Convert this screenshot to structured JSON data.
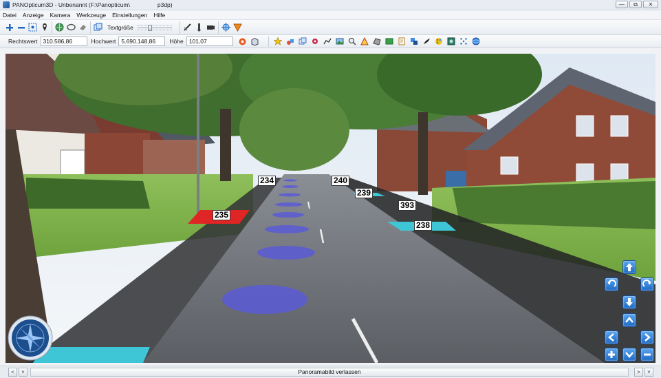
{
  "window": {
    "title_app": "PANOpticum3D - Unbenannt (F:\\Panopticum\\",
    "title_suffix": "p3dp)",
    "btn_minimize": "—",
    "btn_maximize": "⧉",
    "btn_close": "✕"
  },
  "menu": [
    "Datei",
    "Anzeige",
    "Kamera",
    "Werkzeuge",
    "Einstellungen",
    "Hilfe"
  ],
  "toolbar1": {
    "text_size_label": "Textgröße",
    "text_size_level": 0.35
  },
  "toolbar2": {
    "rechtswert_label": "Rechtswert",
    "rechtswert_value": "310.586,86",
    "hochwert_label": "Hochwert",
    "hochwert_value": "5.690.148,86",
    "hoehe_label": "Höhe",
    "hoehe_value": "101,07"
  },
  "segments": [
    {
      "label": "234",
      "color": "#a9a9a9"
    },
    {
      "label": "240",
      "color": "#a9a9a9"
    },
    {
      "label": "239",
      "color": "#3fc6d6"
    },
    {
      "label": "235",
      "color": "#e02525"
    },
    {
      "label": "393",
      "color": "#a9a9a9"
    },
    {
      "label": "238",
      "color": "#3fc6d6"
    }
  ],
  "status": {
    "center_text": "Panoramabild verlassen",
    "left_btn1": "<",
    "left_btn2": "˅",
    "right_btn1": ">",
    "right_btn2": "˅"
  },
  "colors": {
    "accent": "#1d68c4",
    "marker": "#5a5ad6",
    "cyan": "#3fc6d6",
    "red": "#e02525"
  }
}
